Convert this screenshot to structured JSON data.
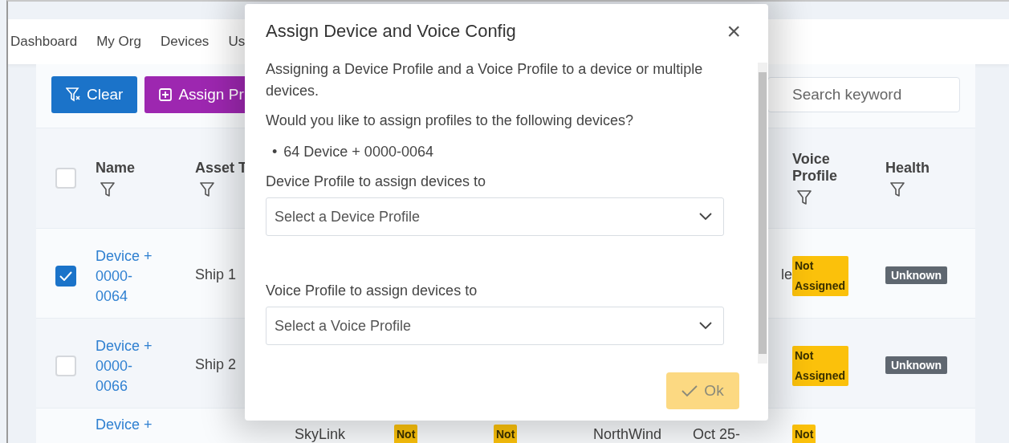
{
  "nav": {
    "items": [
      {
        "label": "Dashboard"
      },
      {
        "label": "My Org"
      },
      {
        "label": "Devices"
      },
      {
        "label": "Us"
      }
    ]
  },
  "toolbar": {
    "buttons": [
      {
        "label": "Clear",
        "kind": "clear"
      },
      {
        "label": "Assign Pr",
        "kind": "assign"
      }
    ],
    "search": {
      "placeholder": "Search keyword"
    }
  },
  "table": {
    "all_checked": false,
    "columns": [
      {
        "label": "Name"
      },
      {
        "label": "Asset T"
      },
      {
        "label": "Voice Profile"
      },
      {
        "label": "Health"
      }
    ],
    "rows": [
      {
        "checked": true,
        "name": "Device + 0000-0064",
        "asset_type": "Ship 1",
        "column_8": "le",
        "voice_profile": "Not Assigned",
        "health": "Unknown"
      },
      {
        "checked": false,
        "name": "Device + 0000-0066",
        "asset_type": "Ship 2",
        "voice_profile": "Not Assigned",
        "health": "Unknown"
      },
      {
        "name": "Device +",
        "column_4": "SkyLink",
        "column_5": "Not",
        "column_6": "Not",
        "column_7": "NorthWind",
        "column_8": "Oct 25-",
        "voice_profile": "Not"
      }
    ]
  },
  "dialog": {
    "title": "Assign Device and Voice Config",
    "close": "×",
    "intro": "Assigning a Device Profile and a Voice Profile to a device or multiple devices.",
    "question": "Would you like to assign profiles to the following devices?",
    "devices": [
      {
        "bullet": "•",
        "text": "64 Device + 0000-0064"
      }
    ],
    "fields": [
      {
        "label": "Device Profile to assign devices to",
        "placeholder": "Select a Device Profile"
      },
      {
        "label": "Voice Profile to assign devices to",
        "placeholder": "Select a Voice Profile"
      }
    ],
    "ok": {
      "label": "Ok",
      "disabled": true
    }
  }
}
